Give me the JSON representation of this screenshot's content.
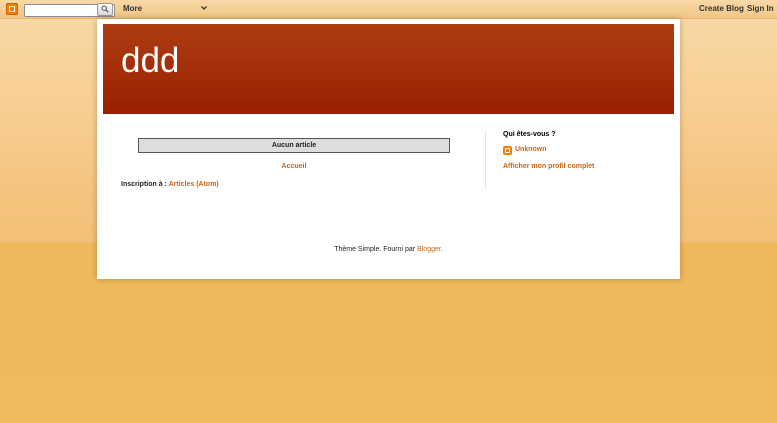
{
  "navbar": {
    "logo_icon": "blogger-logo-icon",
    "search_icon": "search-icon",
    "search_placeholder": "",
    "more_label": "More",
    "more_icon": "chevron-down-icon",
    "create_blog_label": "Create Blog",
    "sign_in_label": "Sign In"
  },
  "header": {
    "title": "ddd"
  },
  "main": {
    "no_posts_label": "Aucun article",
    "home_label": "Accueil",
    "subscribe_prefix": "Inscription à : ",
    "subscribe_link": "Articles (Atom)"
  },
  "sidebar": {
    "title": "Qui êtes-vous ?",
    "profile_icon": "blogger-profile-icon",
    "profile_name": "Unknown",
    "profile_link": "Afficher mon profil complet"
  },
  "footer": {
    "attribution_prefix": "Thème Simple. Fourni par ",
    "attribution_link": "Blogger",
    "attribution_suffix": "."
  },
  "colors": {
    "header_background": "#a52e08",
    "link": "#cc6611",
    "page_background": "#efb95c",
    "blogger_orange": "#f57d00"
  }
}
